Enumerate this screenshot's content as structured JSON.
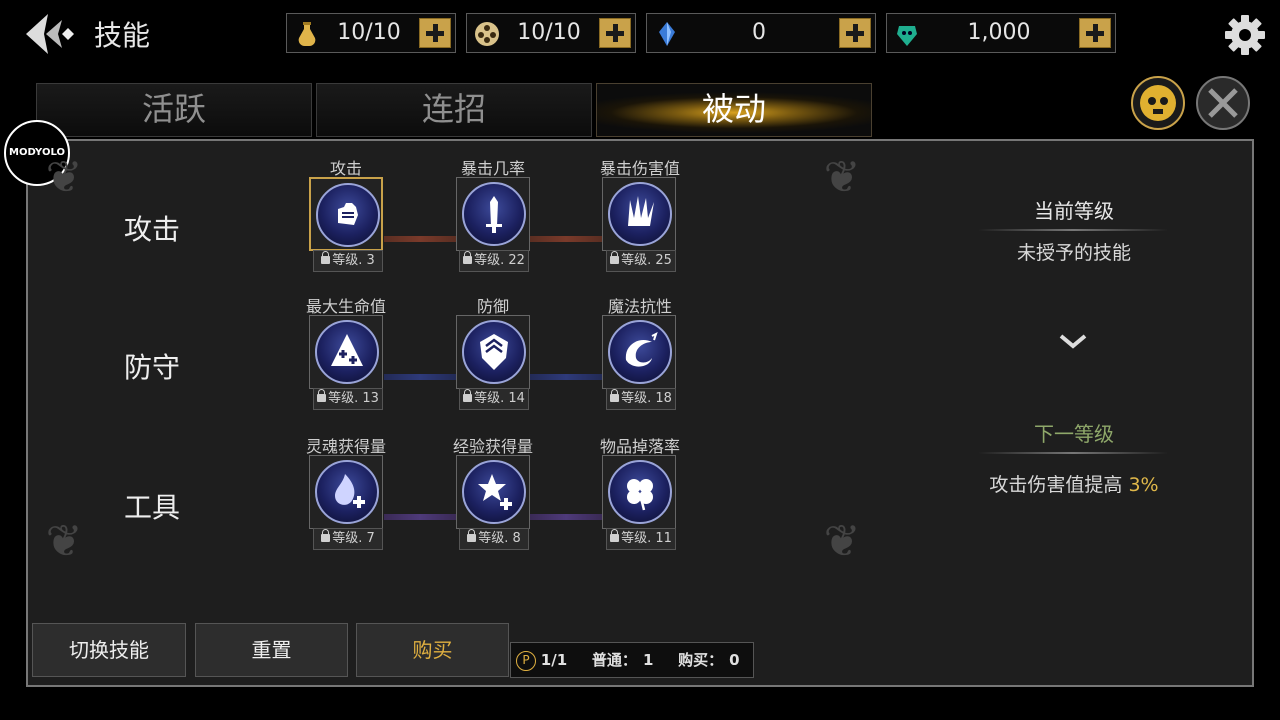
{
  "header": {
    "title": "技能",
    "resources": [
      {
        "icon": "potion-icon",
        "value": "10/10"
      },
      {
        "icon": "film-reel-icon",
        "value": "10/10"
      },
      {
        "icon": "blue-crystal-icon",
        "value": "0"
      },
      {
        "icon": "soul-gem-icon",
        "value": "1,000"
      }
    ]
  },
  "tabs": [
    {
      "label": "活跃",
      "active": false
    },
    {
      "label": "连招",
      "active": false
    },
    {
      "label": "被动",
      "active": true
    }
  ],
  "watermark": "MODYOLO",
  "skill_rows": [
    {
      "label": "攻击",
      "skills": [
        {
          "title": "攻击",
          "level": "等级. 3",
          "icon": "fist-icon",
          "selected": true
        },
        {
          "title": "暴击几率",
          "level": "等级. 22",
          "icon": "sword-icon"
        },
        {
          "title": "暴击伤害值",
          "level": "等级. 25",
          "icon": "claw-icon"
        }
      ]
    },
    {
      "label": "防守",
      "skills": [
        {
          "title": "最大生命值",
          "level": "等级. 13",
          "icon": "health-plus-icon"
        },
        {
          "title": "防御",
          "level": "等级. 14",
          "icon": "shield-icon"
        },
        {
          "title": "魔法抗性",
          "level": "等级. 18",
          "icon": "magic-swirl-icon"
        }
      ]
    },
    {
      "label": "工具",
      "skills": [
        {
          "title": "灵魂获得量",
          "level": "等级. 7",
          "icon": "soul-plus-icon"
        },
        {
          "title": "经验获得量",
          "level": "等级. 8",
          "icon": "xp-plus-icon"
        },
        {
          "title": "物品掉落率",
          "level": "等级. 11",
          "icon": "clover-icon"
        }
      ]
    }
  ],
  "info": {
    "current_heading": "当前等级",
    "current_value": "未授予的技能",
    "next_heading": "下一等级",
    "next_desc": "攻击伤害值提高",
    "next_value": "3%"
  },
  "bottom": {
    "switch_label": "切换技能",
    "reset_label": "重置",
    "buy_label": "购买",
    "points": "1/1",
    "normal_label": "普通：",
    "normal_value": "1",
    "buy_count_label": "购买：",
    "buy_count_value": "0"
  },
  "colors": {
    "accent_gold": "#c9a24a",
    "next_heading_green": "#8fa86a",
    "percent_gold": "#e0b84a"
  }
}
